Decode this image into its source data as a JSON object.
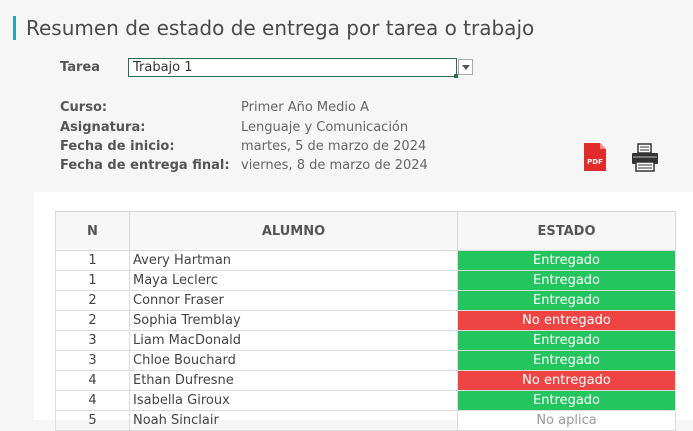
{
  "page": {
    "title": "Resumen de estado de entrega por tarea o trabajo"
  },
  "selector": {
    "label": "Tarea",
    "value": "Trabajo 1"
  },
  "info": {
    "curso_label": "Curso:",
    "curso_value": "Primer Año Medio A",
    "asignatura_label": "Asignatura:",
    "asignatura_value": "Lenguaje y Comunicación",
    "inicio_label": "Fecha de inicio:",
    "inicio_value": "martes, 5 de marzo de 2024",
    "entrega_label": "Fecha de entrega final:",
    "entrega_value": "viernes, 8 de marzo de 2024"
  },
  "actions": {
    "pdf_icon": "pdf-icon",
    "print_icon": "printer-icon",
    "pdf_text": "PDF"
  },
  "table": {
    "headers": [
      "N",
      "ALUMNO",
      "ESTADO"
    ],
    "rows": [
      {
        "n": "1",
        "alumno": "Avery Hartman",
        "estado": "Entregado"
      },
      {
        "n": "1",
        "alumno": "Maya Leclerc",
        "estado": "Entregado"
      },
      {
        "n": "2",
        "alumno": "Connor Fraser",
        "estado": "Entregado"
      },
      {
        "n": "2",
        "alumno": "Sophia Tremblay",
        "estado": "No entregado"
      },
      {
        "n": "3",
        "alumno": "Liam MacDonald",
        "estado": "Entregado"
      },
      {
        "n": "3",
        "alumno": "Chloe Bouchard",
        "estado": "Entregado"
      },
      {
        "n": "4",
        "alumno": "Ethan Dufresne",
        "estado": "No entregado"
      },
      {
        "n": "4",
        "alumno": "Isabella Giroux",
        "estado": "Entregado"
      },
      {
        "n": "5",
        "alumno": "Noah Sinclair",
        "estado": "No aplica"
      }
    ]
  },
  "colors": {
    "accent": "#29a3b8",
    "entregado": "#22c55e",
    "no_entregado": "#ef4444"
  }
}
